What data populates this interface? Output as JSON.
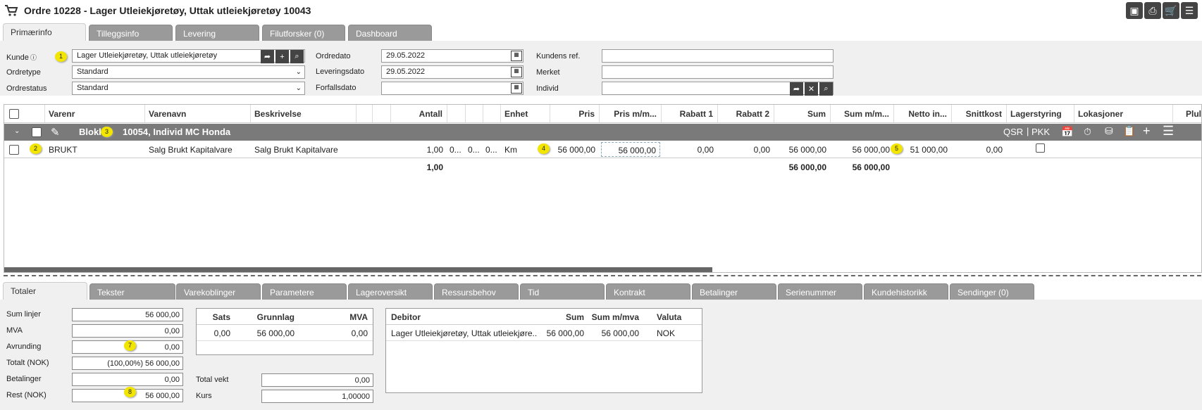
{
  "window": {
    "title": "Ordre 10228 - Lager Utleiekjøretøy, Uttak utleiekjøretøy 10043"
  },
  "toolbar": {
    "save_icon": "save-icon",
    "print_icon": "print-icon",
    "cart_icon": "cart-icon",
    "menu_icon": "menu-icon"
  },
  "top_tabs": [
    "Primærinfo",
    "Tilleggsinfo",
    "Levering",
    "Filutforsker (0)",
    "Dashboard"
  ],
  "form": {
    "kunde_label": "Kunde",
    "kunde_value": "Lager Utleiekjøretøy, Uttak utleiekjøretøy",
    "ordretype_label": "Ordretype",
    "ordretype_value": "Standard",
    "ordrestatus_label": "Ordrestatus",
    "ordrestatus_value": "Standard",
    "ordredato_label": "Ordredato",
    "ordredato_value": "29.05.2022",
    "leveringsdato_label": "Leveringsdato",
    "leveringsdato_value": "29.05.2022",
    "forfallsdato_label": "Forfallsdato",
    "forfallsdato_value": "",
    "kundens_ref_label": "Kundens ref.",
    "kundens_ref_value": "",
    "merket_label": "Merket",
    "merket_value": "",
    "individ_label": "Individ",
    "individ_value": ""
  },
  "grid": {
    "headers": [
      "Varenr",
      "Varenavn",
      "Beskrivelse",
      "Antall",
      "Enhet",
      "Pris",
      "Pris m/m...",
      "Rabatt 1",
      "Rabatt 2",
      "Sum",
      "Sum m/m...",
      "Netto in...",
      "Snittkost",
      "Lagerstyring",
      "Lokasjoner",
      "Plul"
    ],
    "block": {
      "label_prefix": "Blokk",
      "label_suffix": "10054, Individ MC Honda",
      "actions": [
        "QSR",
        "PKK"
      ]
    },
    "row": {
      "varenr": "BRUKT",
      "varenavn": "Salg Brukt Kapitalvare",
      "beskrivelse": "Salg Brukt Kapitalvare",
      "antall": "1,00",
      "c1": "0...",
      "c2": "0...",
      "c3": "0...",
      "enhet": "Km",
      "pris": "56 000,00",
      "pris_mva": "56 000,00",
      "rabatt1": "0,00",
      "rabatt2": "0,00",
      "sum": "56 000,00",
      "sum_mva": "56 000,00",
      "netto": "51 000,00",
      "snittkost": "0,00"
    },
    "totals": {
      "antall": "1,00",
      "sum": "56 000,00",
      "sum_mva": "56 000,00"
    }
  },
  "bottom_tabs": [
    "Totaler",
    "Tekster",
    "Varekoblinger",
    "Parametere",
    "Lageroversikt",
    "Ressursbehov",
    "Tid",
    "Kontrakt",
    "Betalinger",
    "Serienummer",
    "Kundehistorikk",
    "Sendinger (0)"
  ],
  "totaler": {
    "sum_linjer_label": "Sum linjer",
    "sum_linjer": "56 000,00",
    "mva_label": "MVA",
    "mva": "0,00",
    "avrunding_label": "Avrunding",
    "avrunding": "0,00",
    "totalt_label": "Totalt (NOK)",
    "totalt": "(100,00%) 56 000,00",
    "betalinger_label": "Betalinger",
    "betalinger": "0,00",
    "rest_label": "Rest (NOK)",
    "rest": "56 000,00"
  },
  "mva_table": {
    "headers": [
      "Sats",
      "Grunnlag",
      "MVA"
    ],
    "row": [
      "0,00",
      "56 000,00",
      "0,00"
    ]
  },
  "weight": {
    "total_vekt_label": "Total vekt",
    "total_vekt": "0,00",
    "kurs_label": "Kurs",
    "kurs": "1,00000"
  },
  "debitor_table": {
    "headers": [
      "Debitor",
      "Sum",
      "Sum m/mva",
      "Valuta"
    ],
    "row": [
      "Lager Utleiekjøretøy, Uttak utleiekjøre...",
      "56 000,00",
      "56 000,00",
      "NOK"
    ]
  },
  "markers": [
    "1",
    "2",
    "3",
    "4",
    "5",
    "7",
    "8"
  ]
}
